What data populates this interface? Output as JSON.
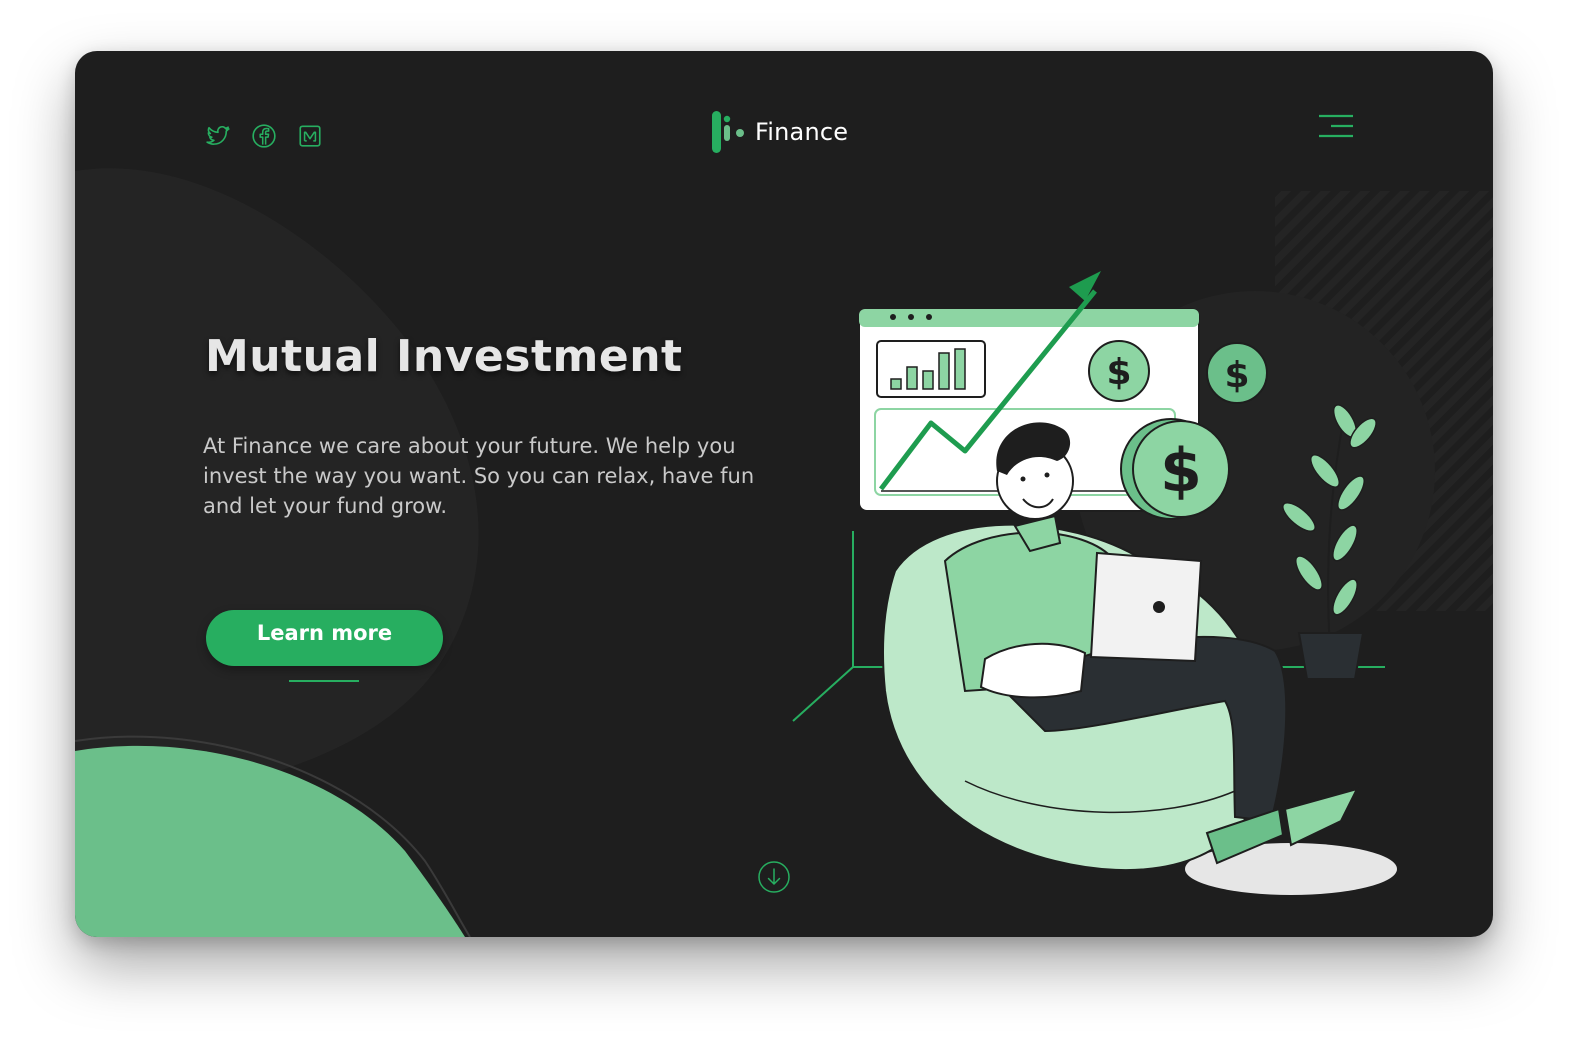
{
  "brand": {
    "name": "Finance",
    "accent": "#27ae60",
    "background": "#1e1e1e"
  },
  "social": [
    {
      "icon": "twitter-icon"
    },
    {
      "icon": "facebook-icon"
    },
    {
      "icon": "medium-icon"
    }
  ],
  "nav": {
    "menu_icon": "hamburger-menu-icon"
  },
  "hero": {
    "title": "Mutual Investment",
    "text": "At Finance we care about your future. We help you invest the way you want. So you can relax, have fun and let your fund grow.",
    "cta_label": "Learn more"
  },
  "scroll": {
    "icon": "arrow-down-circle-icon"
  },
  "illustration": {
    "subject": "man-on-beanbag-with-laptop-illustration"
  }
}
